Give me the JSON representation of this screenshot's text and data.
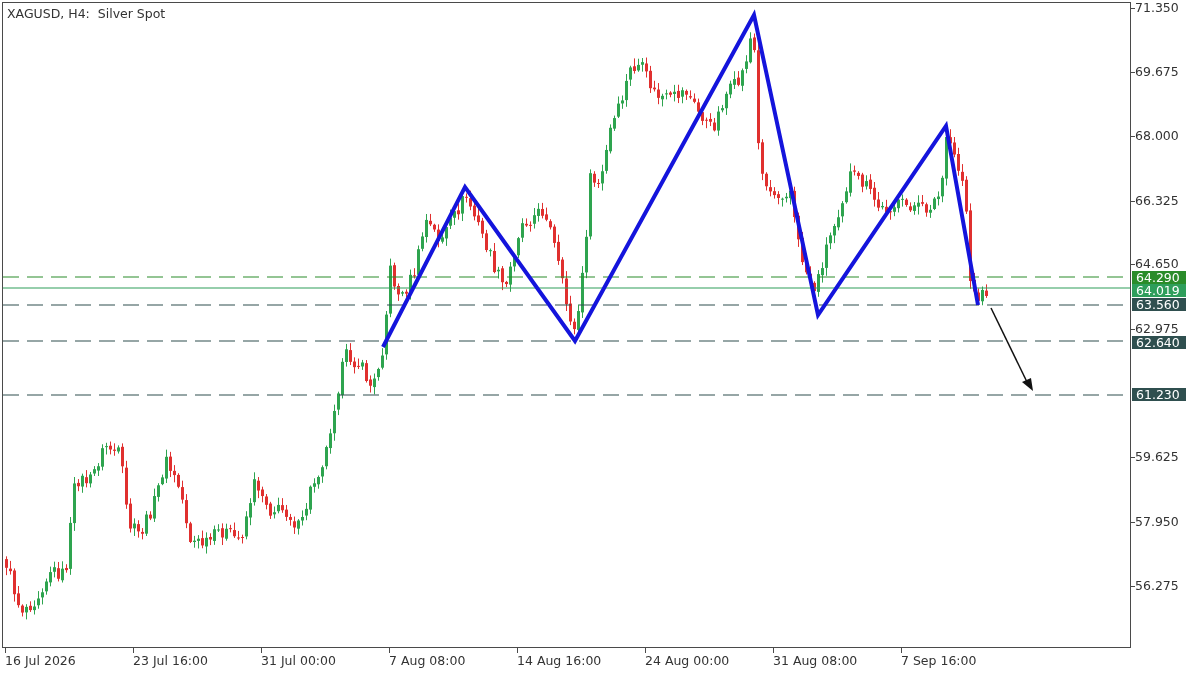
{
  "chart": {
    "title": "XAGUSD, H4:  Silver Spot"
  },
  "price_axis": {
    "labels": [
      "71.350",
      "69.675",
      "68.000",
      "66.325",
      "64.650",
      "62.975",
      "59.625",
      "57.950",
      "56.275"
    ]
  },
  "price_levels": [
    {
      "label": "64.290",
      "kind": "dashed",
      "color": "#2a8c2a"
    },
    {
      "label": "64.019",
      "kind": "solid",
      "color": "#2e9e5b"
    },
    {
      "label": "63.560",
      "kind": "dashed",
      "color": "#2f4f4f"
    },
    {
      "label": "62.640",
      "kind": "dashed",
      "color": "#2f4f4f"
    },
    {
      "label": "61.230",
      "kind": "dashed",
      "color": "#2f4f4f"
    }
  ],
  "time_axis": {
    "labels": [
      "16 Jul 2026",
      "23 Jul 16:00",
      "31 Jul 00:00",
      "7 Aug 08:00",
      "14 Aug 16:00",
      "24 Aug 00:00",
      "31 Aug 08:00",
      "7 Sep 16:00"
    ]
  }
}
